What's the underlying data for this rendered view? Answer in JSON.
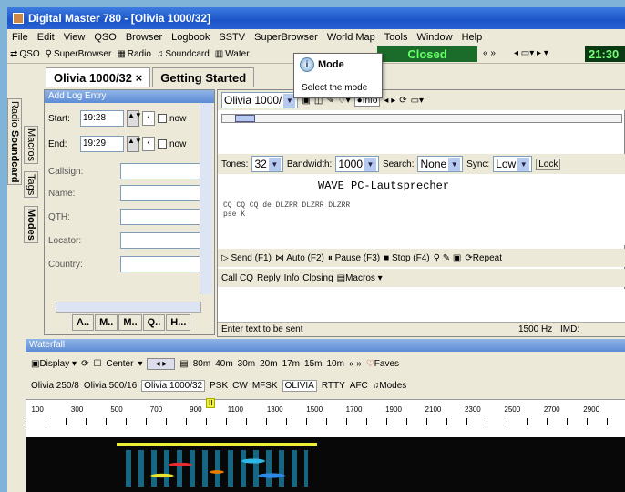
{
  "window": {
    "title": "Digital Master 780 - [Olivia 1000/32]"
  },
  "menu": [
    "File",
    "Edit",
    "View",
    "QSO",
    "Browser",
    "Logbook",
    "SSTV",
    "SuperBrowser",
    "World Map",
    "Tools",
    "Window",
    "Help"
  ],
  "toolbar": {
    "qso": "QSO",
    "superbrowser": "SuperBrowser",
    "radio": "Radio",
    "soundcard": "Soundcard",
    "waterfall": "Water",
    "status": "Closed",
    "clock": "21:30"
  },
  "tooltip": {
    "title": "Mode",
    "text": "Select the mode"
  },
  "doc_tabs": [
    "Olivia 1000/32",
    "Getting Started"
  ],
  "side_tabs": [
    "Radio",
    "Soundcard",
    "Macros",
    "Tags",
    "Modes"
  ],
  "log_entry": {
    "title": "Add Log Entry",
    "start_label": "Start:",
    "start_time": "19:28",
    "end_label": "End:",
    "end_time": "19:29",
    "now_label": "now",
    "fields": [
      "Callsign:",
      "Name:",
      "QTH:",
      "Locator:",
      "Country:"
    ],
    "bottom_tabs": [
      "A..",
      "M..",
      "M..",
      "Q..",
      "H..."
    ]
  },
  "mode_panel": {
    "mode_value": "Olivia 1000/",
    "info_label": "Info",
    "tones_label": "Tones:",
    "tones_value": "32",
    "bandwidth_label": "Bandwidth:",
    "bandwidth_value": "1000",
    "search_label": "Search:",
    "search_value": "None",
    "sync_label": "Sync:",
    "sync_value": "Low",
    "lock_label": "Lock",
    "rx_title": "WAVE PC-Lautsprecher",
    "rx_line1": "CQ CQ CQ de DLZRR DLZRR DLZRR",
    "rx_line2": "pse K",
    "tx_buttons": [
      "Send (F1)",
      "Auto (F2)",
      "Pause (F3)",
      "Stop (F4)",
      "Repeat"
    ],
    "macro_buttons": [
      "Call CQ",
      "Reply",
      "Info",
      "Closing",
      "Macros"
    ],
    "status_text": "Enter text to be sent",
    "freq": "1500 Hz",
    "imd": "IMD:"
  },
  "waterfall": {
    "title": "Waterfall",
    "display_label": "Display",
    "center_label": "Center",
    "bands": [
      "80m",
      "40m",
      "30m",
      "20m",
      "17m",
      "15m",
      "10m"
    ],
    "faves_label": "Faves",
    "modes": [
      "Olivia 250/8",
      "Olivia 500/16",
      "Olivia 1000/32",
      "PSK",
      "CW",
      "MFSK",
      "OLIVIA",
      "RTTY",
      "AFC",
      "Modes"
    ],
    "marker": "II",
    "scale": [
      "100",
      "300",
      "500",
      "700",
      "900",
      "1100",
      "1300",
      "1500",
      "1700",
      "1900",
      "2100",
      "2300",
      "2500",
      "2700",
      "2900"
    ]
  }
}
